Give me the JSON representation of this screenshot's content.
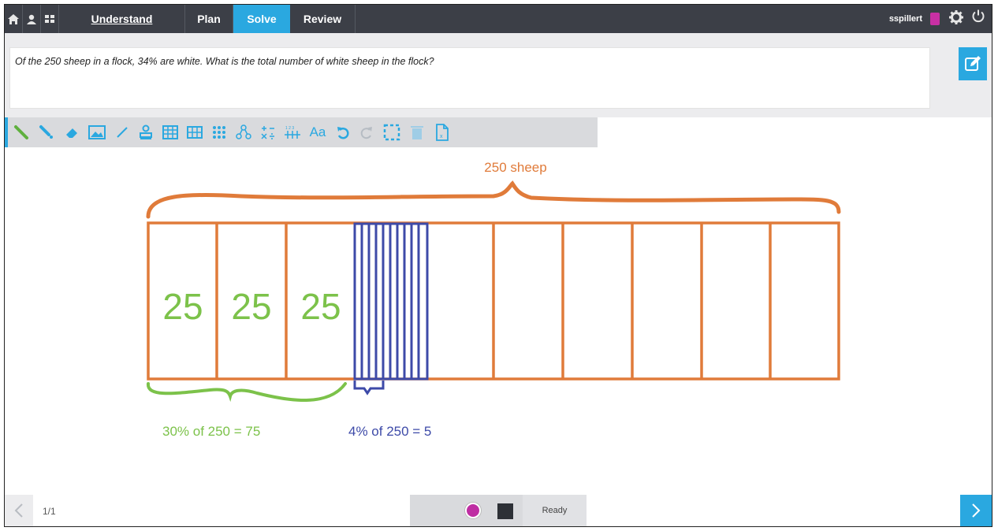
{
  "nav": {
    "home_icon": "home-icon",
    "user_icon": "user-icon",
    "grid_icon": "grid-icon",
    "tabs": [
      {
        "label": "Understand"
      },
      {
        "label": "Plan"
      },
      {
        "label": "Solve"
      },
      {
        "label": "Review"
      }
    ],
    "active_tab": "Solve",
    "username": "sspillert"
  },
  "question": {
    "text": "Of the 250 sheep in a flock, 34% are white. What is the total number of white sheep in the flock?"
  },
  "toolbar": {
    "tools": [
      "pencil-icon",
      "highlighter-icon",
      "eraser-icon",
      "image-icon",
      "line-icon",
      "stamp-icon",
      "table-icon",
      "grid-table-icon",
      "array-icon",
      "number-bond-icon",
      "operations-icon",
      "number-line-icon",
      "text-icon",
      "undo-icon",
      "redo-icon",
      "select-icon",
      "trash-icon",
      "page-icon"
    ]
  },
  "canvas": {
    "total_label": "250 sheep",
    "cell_values": [
      "25",
      "25",
      "25"
    ],
    "green_label": "30% of 250 = 75",
    "blue_label": "4% of 250 = 5",
    "colors": {
      "orange": "#e07b3a",
      "green": "#7cc24a",
      "blue": "#3d4aa8"
    }
  },
  "footer": {
    "page_indicator": "1/1",
    "status": "Ready",
    "pen_color": "#bf2ea3",
    "fill_color": "#2d3036"
  }
}
